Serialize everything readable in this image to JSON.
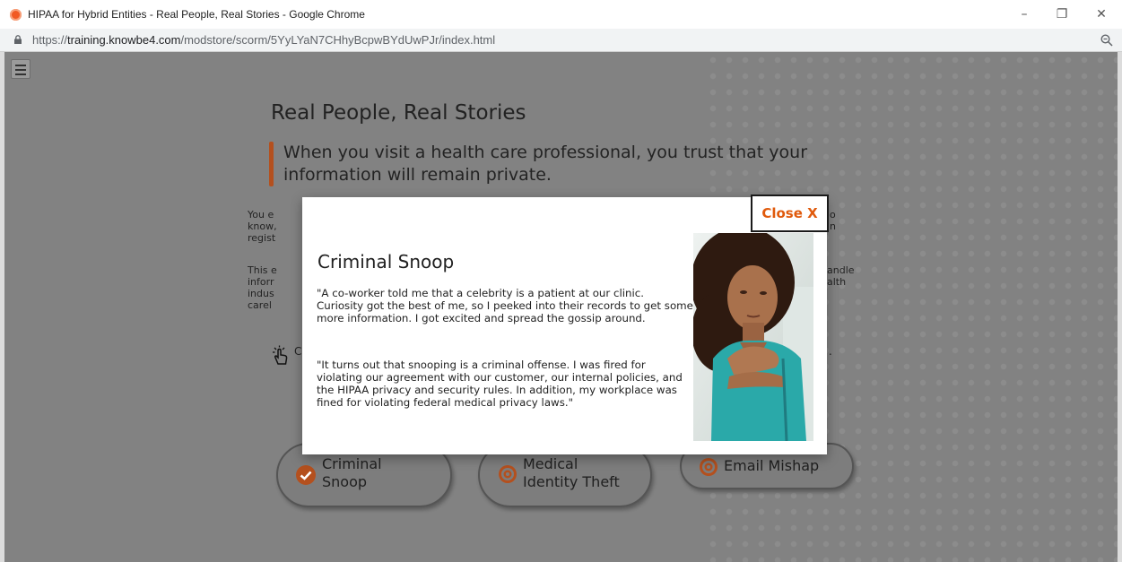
{
  "browser": {
    "window_title": "HIPAA for Hybrid Entities - Real People, Real Stories - Google Chrome",
    "url_scheme": "https://",
    "url_host": "training.knowbe4.com",
    "url_path": "/modstore/scorm/5YyLYaN7CHhyBcpwBYdUwPJr/index.html",
    "minimize_label": "–",
    "restore_label": "❐",
    "close_label": "✕"
  },
  "background": {
    "heading": "Real People, Real Stories",
    "quote": "When you visit a health care professional, you trust that your information will remain private.",
    "para1_left": [
      "You e",
      "know,",
      "regist"
    ],
    "para1_right": [
      "o",
      "n"
    ],
    "para2_left": [
      "This e",
      "inforr",
      "indus",
      "carel"
    ],
    "para2_right": [
      "andle",
      "alth"
    ],
    "instruction_left": "C",
    "instruction_right": "."
  },
  "choices": [
    {
      "line1": "Criminal",
      "line2": "Snoop",
      "status": "completed"
    },
    {
      "line1": "Medical",
      "line2": "Identity Theft",
      "status": "not-started"
    },
    {
      "line1": "Email Mishap",
      "line2": "",
      "status": "not-started"
    }
  ],
  "modal": {
    "close_label": "Close X",
    "title": "Criminal Snoop",
    "paragraph1": "\"A co-worker told me that a celebrity is a patient at our clinic. Curiosity got the best of me, so I peeked into their records to get some more information. I got excited and spread the gossip around.",
    "paragraph2": "\"It turns out that snooping is a criminal offense. I was fired for violating our agreement with our customer, our internal policies, and the HIPAA privacy and security rules. In addition, my workplace was fined for violating federal medical privacy laws.\""
  },
  "colors": {
    "accent": "#e05a0c",
    "quote_bar": "#b4501e",
    "overlay": "#828282"
  },
  "icons": [
    "favicon-icon",
    "lock-icon",
    "zoom-icon",
    "menu-icon",
    "hand-pointer-icon",
    "checkmark-icon",
    "target-icon"
  ]
}
